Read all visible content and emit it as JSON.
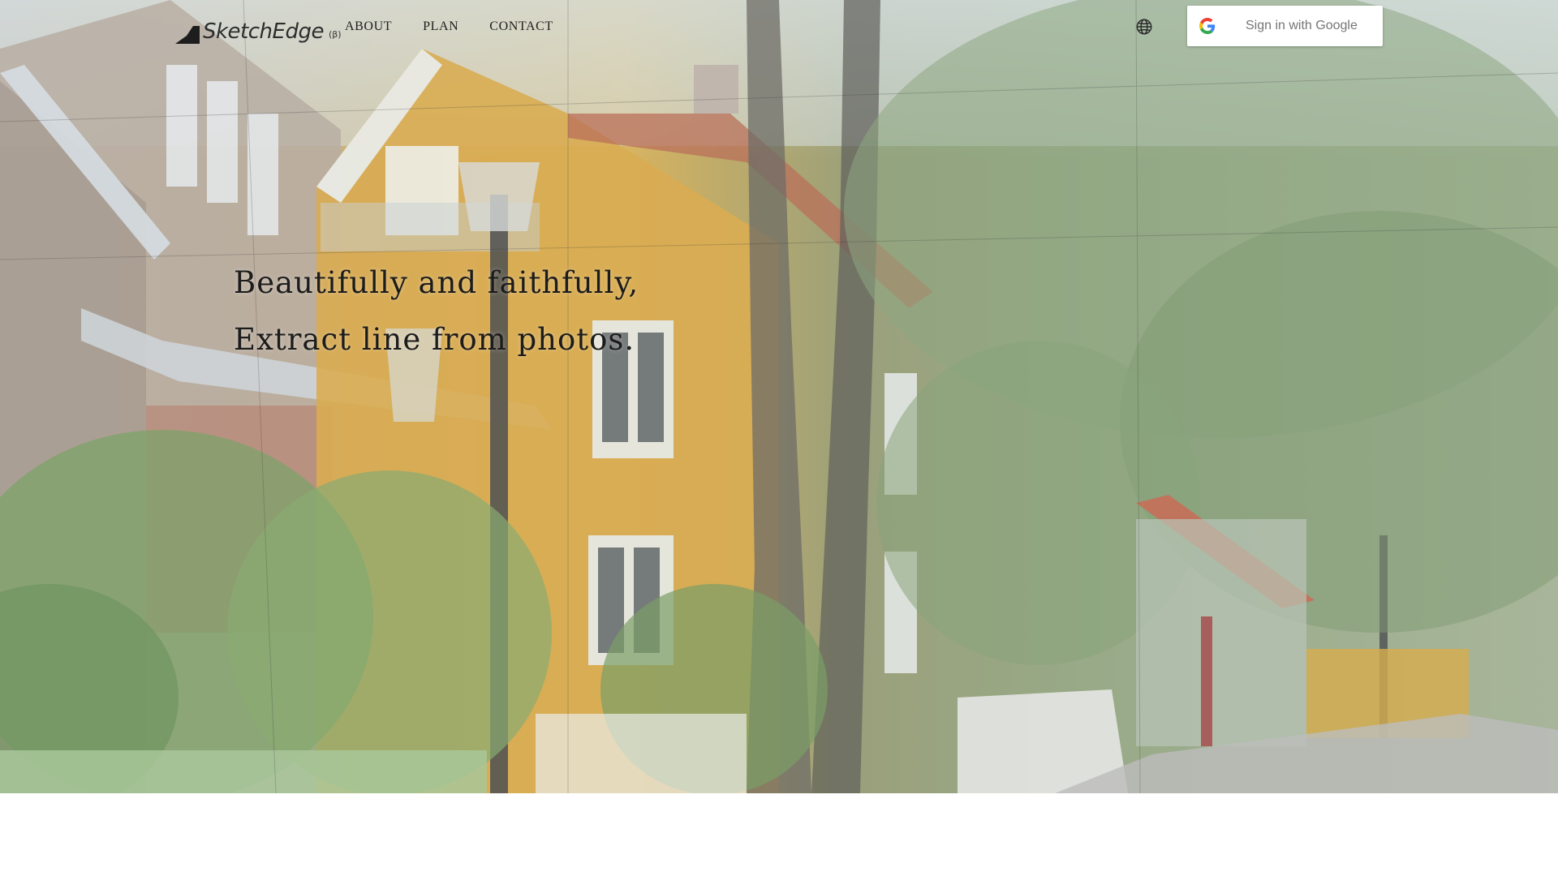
{
  "brand": {
    "name": "SketchEdge",
    "badge": "(β)",
    "logo_icon": "mountain-triangle-icon"
  },
  "nav": {
    "items": [
      "ABOUT",
      "PLAN",
      "CONTACT"
    ]
  },
  "header": {
    "language_icon": "globe-icon",
    "signin_label": "Sign in with Google",
    "signin_icon": "google-g-icon"
  },
  "hero": {
    "line1": "Beautifully and faithfully,",
    "line2": "Extract line from photos."
  },
  "colors": {
    "google_blue": "#4285F4",
    "google_red": "#EA4335",
    "google_yellow": "#FBBC05",
    "google_green": "#34A853",
    "text_dark": "#1c1c1c",
    "signin_text": "#757575"
  }
}
